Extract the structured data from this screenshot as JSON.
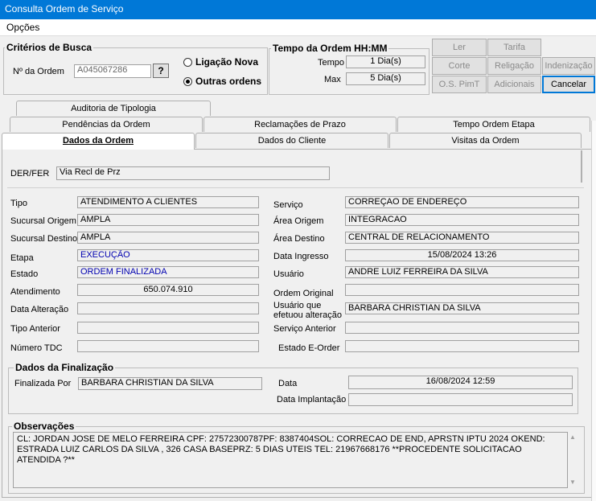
{
  "window": {
    "title": "Consulta Ordem de Serviço"
  },
  "menu": {
    "opcoes": "Opções"
  },
  "search": {
    "group_label": "Critérios de Busca",
    "order_label": "Nº da Ordem",
    "order_value": "A045067286",
    "lookup_label": "?",
    "radio_ligacao": "Ligação Nova",
    "radio_outras": "Outras ordens",
    "selected": "Outras ordens"
  },
  "tempo": {
    "group_label": "Tempo da Ordem HH:MM",
    "tempo_label": "Tempo",
    "tempo_value": "1 Dia(s)",
    "max_label": "Max",
    "max_value": "5 Dia(s)"
  },
  "buttons": {
    "ler": "Ler",
    "tarifa": "Tarifa",
    "corte": "Corte",
    "religacao": "Religação",
    "indenizacao": "Indenização",
    "os_pimt": "O.S. PimT",
    "adicionais": "Adicionais",
    "cancelar": "Cancelar"
  },
  "tabs": {
    "auditoria": "Auditoria de Tipologia",
    "pendencias": "Pendências da Ordem",
    "reclamacoes": "Reclamações de Prazo",
    "tempo_etapa": "Tempo Ordem Etapa",
    "dados_ordem": "Dados da Ordem",
    "dados_cliente": "Dados do Cliente",
    "visitas": "Visitas da Ordem"
  },
  "form": {
    "der_fer_label": "DER/FER",
    "der_fer": "Via Recl de Prz",
    "tipo_label": "Tipo",
    "tipo": "ATENDIMENTO A CLIENTES",
    "servico_label": "Serviço",
    "servico": "CORREÇAO DE ENDEREÇO",
    "suc_origem_label": "Sucursal Origem",
    "suc_origem": "AMPLA",
    "area_origem_label": "Área Origem",
    "area_origem": "INTEGRACAO",
    "suc_destino_label": "Sucursal Destino",
    "suc_destino": "AMPLA",
    "area_destino_label": "Área Destino",
    "area_destino": "CENTRAL DE RELACIONAMENTO",
    "etapa_label": "Etapa",
    "etapa": "EXECUÇÃO",
    "data_ingresso_label": "Data Ingresso",
    "data_ingresso": "15/08/2024 13:26",
    "estado_label": "Estado",
    "estado": "ORDEM FINALIZADA",
    "usuario_label": "Usuário",
    "usuario": "ANDRE LUIZ FERREIRA DA SILVA",
    "atendimento_label": "Atendimento",
    "atendimento": "650.074.910",
    "ordem_original_label": "Ordem Original",
    "ordem_original": "",
    "data_alteracao_label": "Data Alteração",
    "data_alteracao": "",
    "usuario_alt_label_1": "Usuário que",
    "usuario_alt_label_2": "efetuou alteração",
    "usuario_alt": "BARBARA CHRISTIAN DA SILVA",
    "tipo_anterior_label": "Tipo Anterior",
    "tipo_anterior": "",
    "servico_anterior_label": "Serviço Anterior",
    "servico_anterior": "",
    "numero_tdc_label": "Número TDC",
    "numero_tdc": "",
    "estado_eorder_label": "Estado E-Order",
    "estado_eorder": ""
  },
  "finalizacao": {
    "group_label": "Dados da Finalização",
    "finalizada_por_label": "Finalizada Por",
    "finalizada_por": "BARBARA CHRISTIAN DA SILVA",
    "data_label": "Data",
    "data": "16/08/2024 12:59",
    "data_implantacao_label": "Data Implantação",
    "data_implantacao": ""
  },
  "observacoes": {
    "group_label": "Observações",
    "text": "CL: JORDAN JOSE DE MELO FERREIRA CPF: 27572300787PF: 8387404SOL: CORRECAO DE END, APRSTN IPTU 2024 OKEND: ESTRADA LUIZ CARLOS DA SILVA , 326 CASA BASEPRZ: 5 DIAS UTEIS TEL: 21967668176 **PROCEDENTE SOLICITACAO ATENDIDA ?**"
  }
}
